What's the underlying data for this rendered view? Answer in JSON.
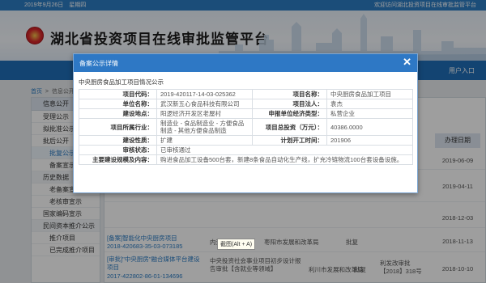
{
  "topbar": {
    "date": "2019年9月26日　星期四",
    "welcome": "欢迎访问湖北投资项目在线审批监管平台"
  },
  "header": {
    "title": "湖北省投资项目在线审批监管平台",
    "nav_right": "用户入口"
  },
  "breadcrumb": {
    "home": "首页",
    "current": "信息公开"
  },
  "sidebar": {
    "items": [
      {
        "label": "信息公开",
        "type": "head"
      },
      {
        "label": "受理公示",
        "type": "item"
      },
      {
        "label": "拟批准公示",
        "type": "item"
      },
      {
        "label": "批后公开",
        "type": "item"
      },
      {
        "label": "批复公示",
        "type": "sub-active"
      },
      {
        "label": "备案宣示",
        "type": "sub"
      },
      {
        "label": "历史数据",
        "type": "group"
      },
      {
        "label": "老备案宣示",
        "type": "sub"
      },
      {
        "label": "老核审宣示",
        "type": "sub"
      },
      {
        "label": "国家编码宣示",
        "type": "item"
      },
      {
        "label": "民间资本推介公示",
        "type": "group"
      },
      {
        "label": "推介项目",
        "type": "sub"
      },
      {
        "label": "已完成推介项目",
        "type": "sub"
      }
    ]
  },
  "list": {
    "date_header": "办理日期",
    "dates": [
      "2019-06-09",
      "2019-04-11",
      "2018-12-03",
      "2018-11-13",
      "2018-10-10"
    ],
    "rows": [
      {
        "title": "[备案]智能化中央厨房项目",
        "code": "2018-420683-35-03-073185",
        "apply": "内资项目备案",
        "dept": "枣阳市发展和改革局",
        "status": "批复"
      },
      {
        "title": "[审批]\"中央厨房\"融合媒体平台建设项目",
        "code": "2017-422802-86-01-134696",
        "apply": "中央投资社会事业项目初步设计报告审批【含就业等领域】",
        "dept": "利川市发展和改革局",
        "status": "批复",
        "doc": "利发改审批【2018】318号"
      }
    ]
  },
  "modal": {
    "title": "备案公示详情",
    "close_icon": "close-icon",
    "subtitle": "中央厨房食品加工项目情况公示",
    "rows": [
      {
        "l1": "项目代码：",
        "v1": "2019-420117-14-03-025362",
        "l2": "项目名称：",
        "v2": "中央厨房食品加工项目"
      },
      {
        "l1": "单位名称：",
        "v1": "武汉新五心食品科技有限公司",
        "l2": "项目法人：",
        "v2": "袁杰"
      },
      {
        "l1": "建设地点：",
        "v1": "阳逻经济开发区老屋村",
        "l2": "申报单位经济类型：",
        "v2": "私营企业"
      },
      {
        "l1": "项目所属行业：",
        "v1": "制造业 - 食品制造业 - 方便食品制造 - 其他方便食品制造",
        "l2": "项目总投资（万元）：",
        "v2": "40386.0000"
      },
      {
        "l1": "建设性质：",
        "v1": "扩建",
        "l2": "计划开工时间：",
        "v2": "201906"
      },
      {
        "l1": "审核状态：",
        "v1": "已审核通过"
      },
      {
        "l1": "主要建设规模及内容：",
        "v1": "购进食品加工设备500台套，新建8条食品自动化生产线，扩充冷链物流100台套设备设施。"
      }
    ]
  },
  "tooltip": {
    "text": "截图(Alt + A)"
  }
}
